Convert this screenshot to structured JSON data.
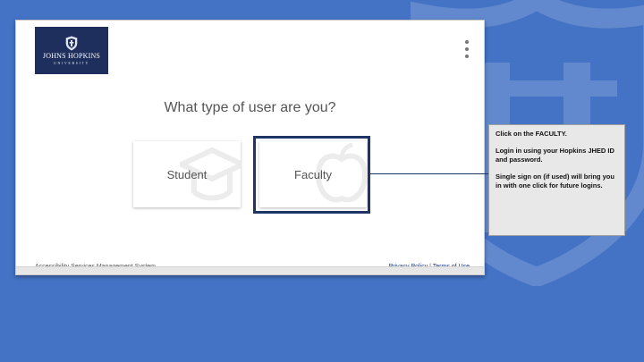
{
  "header": {
    "logo_name": "JOHNS HOPKINS",
    "logo_sub": "UNIVERSITY",
    "menu_icon": "kebab-menu-icon"
  },
  "main": {
    "title": "What type of user are you?",
    "options": [
      {
        "label": "Student",
        "icon": "graduation-cap-icon"
      },
      {
        "label": "Faculty",
        "icon": "apple-icon"
      }
    ]
  },
  "footer": {
    "system_name": "Accessibility Services Management System",
    "privacy_link": "Privacy Policy",
    "separator": "|",
    "terms_link": "Terms of Use"
  },
  "callout": {
    "line1": "Click on the FACULTY.",
    "line2": "Login in using your Hopkins JHED ID and password.",
    "line3": "Single sign on (if used) will bring you in with one click for future logins."
  },
  "colors": {
    "background": "#4472c4",
    "logo_bg": "#1e2f5e",
    "highlight": "#1f3566",
    "callout_bg": "#e8e8e8"
  }
}
